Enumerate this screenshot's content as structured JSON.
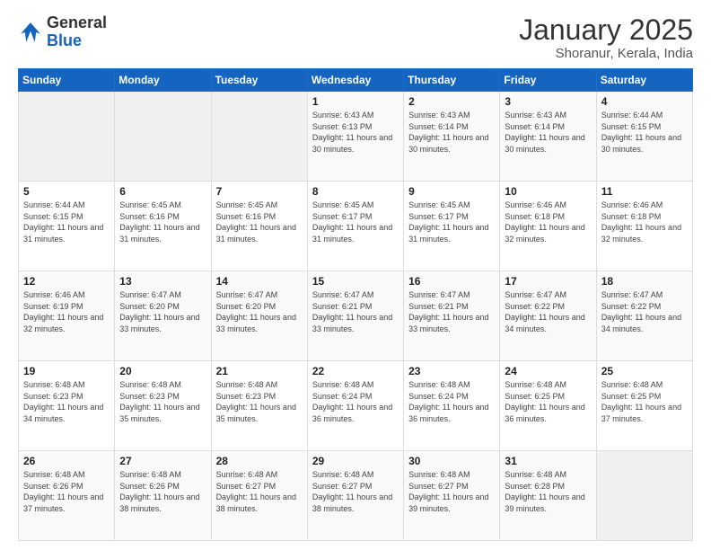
{
  "header": {
    "logo_general": "General",
    "logo_blue": "Blue",
    "title": "January 2025",
    "subtitle": "Shoranur, Kerala, India"
  },
  "weekdays": [
    "Sunday",
    "Monday",
    "Tuesday",
    "Wednesday",
    "Thursday",
    "Friday",
    "Saturday"
  ],
  "weeks": [
    [
      {
        "day": "",
        "empty": true
      },
      {
        "day": "",
        "empty": true
      },
      {
        "day": "",
        "empty": true
      },
      {
        "day": "1",
        "sunrise": "6:43 AM",
        "sunset": "6:13 PM",
        "daylight": "11 hours and 30 minutes."
      },
      {
        "day": "2",
        "sunrise": "6:43 AM",
        "sunset": "6:14 PM",
        "daylight": "11 hours and 30 minutes."
      },
      {
        "day": "3",
        "sunrise": "6:43 AM",
        "sunset": "6:14 PM",
        "daylight": "11 hours and 30 minutes."
      },
      {
        "day": "4",
        "sunrise": "6:44 AM",
        "sunset": "6:15 PM",
        "daylight": "11 hours and 30 minutes."
      }
    ],
    [
      {
        "day": "5",
        "sunrise": "6:44 AM",
        "sunset": "6:15 PM",
        "daylight": "11 hours and 31 minutes."
      },
      {
        "day": "6",
        "sunrise": "6:45 AM",
        "sunset": "6:16 PM",
        "daylight": "11 hours and 31 minutes."
      },
      {
        "day": "7",
        "sunrise": "6:45 AM",
        "sunset": "6:16 PM",
        "daylight": "11 hours and 31 minutes."
      },
      {
        "day": "8",
        "sunrise": "6:45 AM",
        "sunset": "6:17 PM",
        "daylight": "11 hours and 31 minutes."
      },
      {
        "day": "9",
        "sunrise": "6:45 AM",
        "sunset": "6:17 PM",
        "daylight": "11 hours and 31 minutes."
      },
      {
        "day": "10",
        "sunrise": "6:46 AM",
        "sunset": "6:18 PM",
        "daylight": "11 hours and 32 minutes."
      },
      {
        "day": "11",
        "sunrise": "6:46 AM",
        "sunset": "6:18 PM",
        "daylight": "11 hours and 32 minutes."
      }
    ],
    [
      {
        "day": "12",
        "sunrise": "6:46 AM",
        "sunset": "6:19 PM",
        "daylight": "11 hours and 32 minutes."
      },
      {
        "day": "13",
        "sunrise": "6:47 AM",
        "sunset": "6:20 PM",
        "daylight": "11 hours and 33 minutes."
      },
      {
        "day": "14",
        "sunrise": "6:47 AM",
        "sunset": "6:20 PM",
        "daylight": "11 hours and 33 minutes."
      },
      {
        "day": "15",
        "sunrise": "6:47 AM",
        "sunset": "6:21 PM",
        "daylight": "11 hours and 33 minutes."
      },
      {
        "day": "16",
        "sunrise": "6:47 AM",
        "sunset": "6:21 PM",
        "daylight": "11 hours and 33 minutes."
      },
      {
        "day": "17",
        "sunrise": "6:47 AM",
        "sunset": "6:22 PM",
        "daylight": "11 hours and 34 minutes."
      },
      {
        "day": "18",
        "sunrise": "6:47 AM",
        "sunset": "6:22 PM",
        "daylight": "11 hours and 34 minutes."
      }
    ],
    [
      {
        "day": "19",
        "sunrise": "6:48 AM",
        "sunset": "6:23 PM",
        "daylight": "11 hours and 34 minutes."
      },
      {
        "day": "20",
        "sunrise": "6:48 AM",
        "sunset": "6:23 PM",
        "daylight": "11 hours and 35 minutes."
      },
      {
        "day": "21",
        "sunrise": "6:48 AM",
        "sunset": "6:23 PM",
        "daylight": "11 hours and 35 minutes."
      },
      {
        "day": "22",
        "sunrise": "6:48 AM",
        "sunset": "6:24 PM",
        "daylight": "11 hours and 36 minutes."
      },
      {
        "day": "23",
        "sunrise": "6:48 AM",
        "sunset": "6:24 PM",
        "daylight": "11 hours and 36 minutes."
      },
      {
        "day": "24",
        "sunrise": "6:48 AM",
        "sunset": "6:25 PM",
        "daylight": "11 hours and 36 minutes."
      },
      {
        "day": "25",
        "sunrise": "6:48 AM",
        "sunset": "6:25 PM",
        "daylight": "11 hours and 37 minutes."
      }
    ],
    [
      {
        "day": "26",
        "sunrise": "6:48 AM",
        "sunset": "6:26 PM",
        "daylight": "11 hours and 37 minutes."
      },
      {
        "day": "27",
        "sunrise": "6:48 AM",
        "sunset": "6:26 PM",
        "daylight": "11 hours and 38 minutes."
      },
      {
        "day": "28",
        "sunrise": "6:48 AM",
        "sunset": "6:27 PM",
        "daylight": "11 hours and 38 minutes."
      },
      {
        "day": "29",
        "sunrise": "6:48 AM",
        "sunset": "6:27 PM",
        "daylight": "11 hours and 38 minutes."
      },
      {
        "day": "30",
        "sunrise": "6:48 AM",
        "sunset": "6:27 PM",
        "daylight": "11 hours and 39 minutes."
      },
      {
        "day": "31",
        "sunrise": "6:48 AM",
        "sunset": "6:28 PM",
        "daylight": "11 hours and 39 minutes."
      },
      {
        "day": "",
        "empty": true
      }
    ]
  ]
}
